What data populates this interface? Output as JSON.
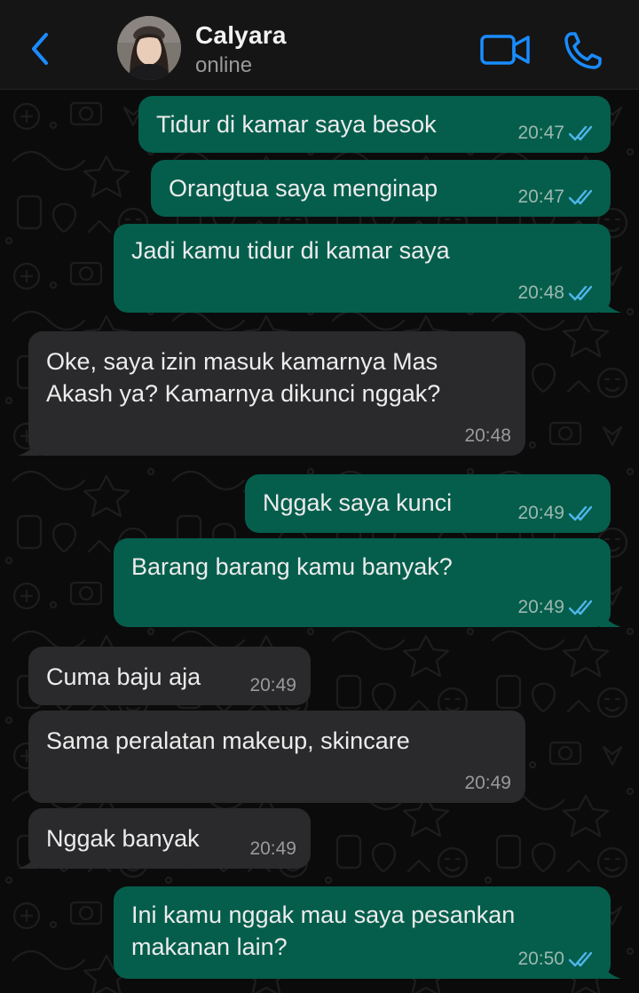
{
  "header": {
    "contact_name": "Calyara",
    "status": "online",
    "back_icon": "chevron-left-icon",
    "video_icon": "video-camera-icon",
    "call_icon": "phone-icon",
    "accent_color": "#1a8cff"
  },
  "messages": [
    {
      "direction": "outgoing",
      "text": "Tidur di kamar saya besok",
      "time": "20:47",
      "status": "read"
    },
    {
      "direction": "outgoing",
      "text": "Orangtua saya menginap",
      "time": "20:47",
      "status": "read"
    },
    {
      "direction": "outgoing",
      "text": "Jadi kamu tidur di kamar saya",
      "time": "20:48",
      "status": "read"
    },
    {
      "direction": "incoming",
      "text": "Oke, saya izin masuk kamarnya Mas\nAkash ya? Kamarnya dikunci nggak?",
      "time": "20:48"
    },
    {
      "direction": "outgoing",
      "text": "Nggak saya kunci",
      "time": "20:49",
      "status": "read"
    },
    {
      "direction": "outgoing",
      "text": "Barang barang kamu banyak?",
      "time": "20:49",
      "status": "read"
    },
    {
      "direction": "incoming",
      "text": "Cuma baju aja",
      "time": "20:49"
    },
    {
      "direction": "incoming",
      "text": "Sama peralatan makeup, skincare",
      "time": "20:49"
    },
    {
      "direction": "incoming",
      "text": "Nggak banyak",
      "time": "20:49"
    },
    {
      "direction": "outgoing",
      "text": "Ini kamu nggak mau saya pesankan\nmakanan lain?",
      "time": "20:50",
      "status": "read"
    }
  ],
  "colors": {
    "outgoing_bubble": "#055e4c",
    "incoming_bubble": "#2a2a2c",
    "read_ticks": "#4fb6ec",
    "background": "#0b0b0b"
  }
}
